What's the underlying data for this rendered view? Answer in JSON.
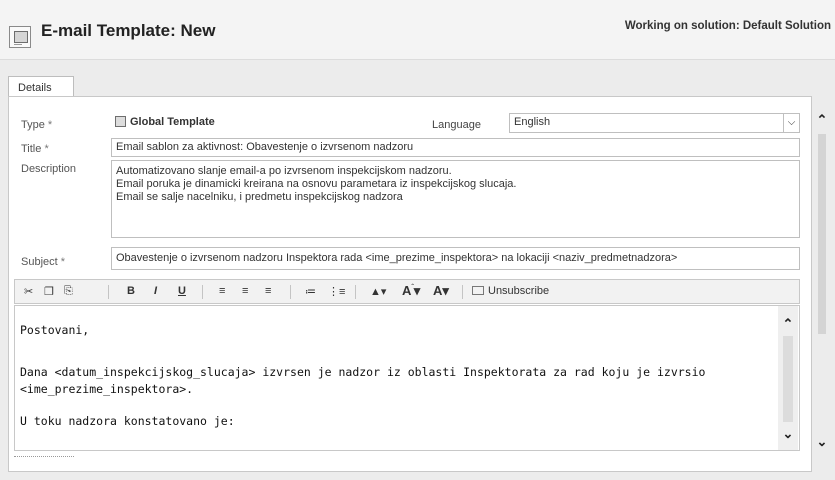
{
  "header": {
    "title": "E-mail Template: New",
    "solution": "Working on solution: Default Solution"
  },
  "tabs": [
    {
      "label": "Details"
    }
  ],
  "form": {
    "type_label": "Type",
    "type_value": "Global Template",
    "language_label": "Language",
    "language_value": "English",
    "title_label": "Title",
    "title_value": "Email sablon za aktivnost: Obavestenje o izvrsenom nadzoru",
    "description_label": "Description",
    "description_lines": [
      "Automatizovano slanje email-a po izvrsenom inspekcijskom nadzoru.",
      "Email poruka je dinamicki kreirana na osnovu parametara iz inspekcijskog slucaja.",
      "Email se salje nacelniku, i predmetu inspekcijskog nadzora"
    ],
    "subject_label": "Subject",
    "subject_value": "Obavestenje o izvrsenom nadzoru Inspektora rada <ime_prezime_inspektora> na lokaciji <naziv_predmetnadzora>",
    "required_marker": "*"
  },
  "toolbar": {
    "bold": "B",
    "italic": "I",
    "underline": "U",
    "font_size_up": "A",
    "font_size_down": "A",
    "unsubscribe": "Unsubscribe"
  },
  "editor": {
    "lines": [
      "Postovani,",
      "",
      "Dana <datum_inspekcijskog_slucaja> izvrsen je nadzor iz oblasti Inspektorata za rad koju je izvrsio",
      "<ime_prezime_inspektora>.",
      "",
      "U toku nadzora konstatovano je:"
    ]
  }
}
